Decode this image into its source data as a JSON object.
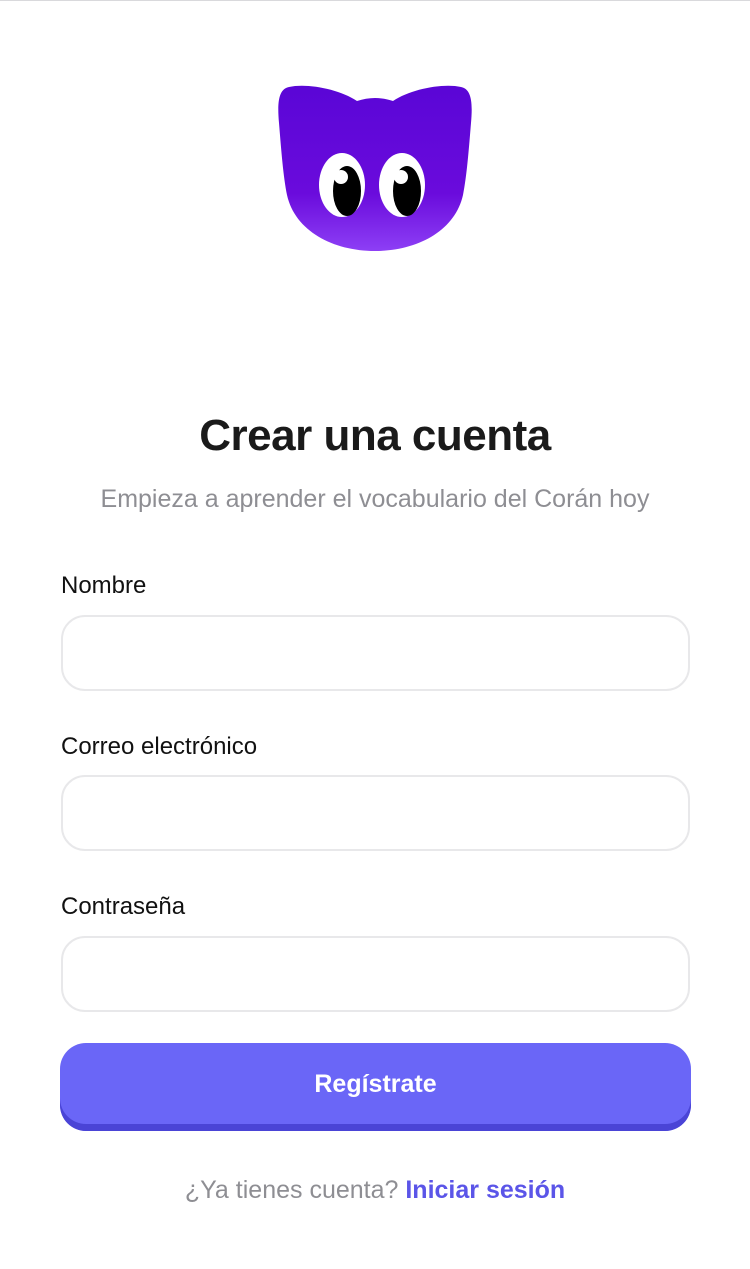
{
  "brand": {
    "logo_icon": "purple-cat-mascot-icon",
    "colors": {
      "logo_purple": "#5a06d6",
      "primary": "#6a66f7",
      "link": "#5b55e8",
      "muted_text": "#8e8e93"
    }
  },
  "header": {
    "title": "Crear una cuenta",
    "subtitle": "Empieza a aprender el vocabulario del Corán hoy"
  },
  "form": {
    "name": {
      "label": "Nombre",
      "value": "",
      "placeholder": ""
    },
    "email": {
      "label": "Correo electrónico",
      "value": "",
      "placeholder": ""
    },
    "password": {
      "label": "Contraseña",
      "value": "",
      "placeholder": ""
    },
    "submit_label": "Regístrate"
  },
  "footer": {
    "prompt": "¿Ya tienes cuenta?",
    "login_link": "Iniciar sesión"
  }
}
